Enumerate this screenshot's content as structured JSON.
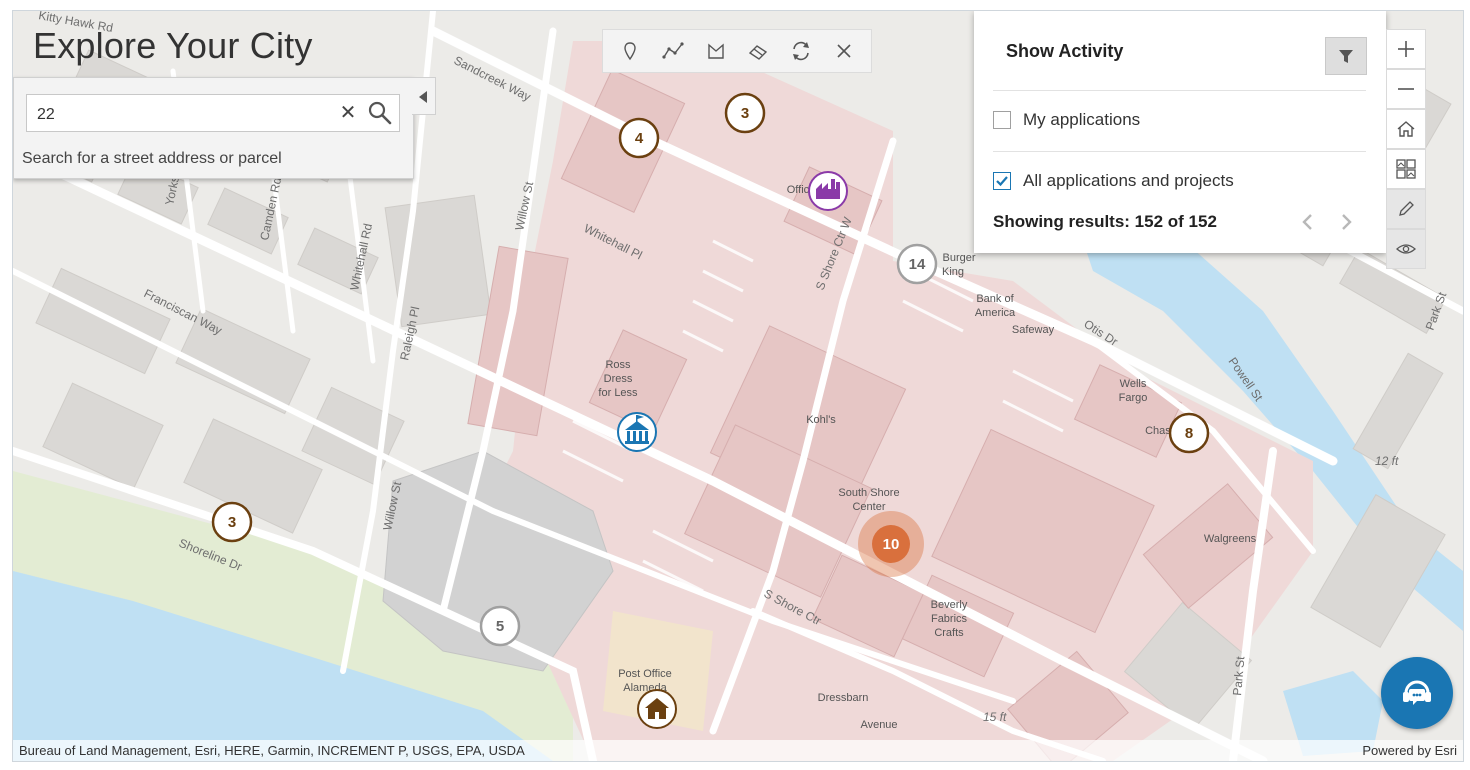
{
  "app": {
    "title": "Explore Your City"
  },
  "search": {
    "value": "22",
    "placeholder": "",
    "hint": "Search for a street address or parcel"
  },
  "activity_panel": {
    "title": "Show Activity",
    "options": [
      {
        "label": "My applications",
        "checked": false
      },
      {
        "label": "All applications and projects",
        "checked": true
      }
    ],
    "results_text": "Showing results: 152 of 152"
  },
  "draw_tools": [
    "point-tool-icon",
    "polyline-tool-icon",
    "polygon-tool-icon",
    "eraser-tool-icon",
    "refresh-icon",
    "close-icon"
  ],
  "map_controls": [
    "zoom-in",
    "zoom-out",
    "home",
    "basemap-gallery",
    "sketch",
    "visibility"
  ],
  "attribution": {
    "left": "Bureau of Land Management, Esri, HERE, Garmin, INCREMENT P, USGS, EPA, USDA",
    "right": "Powered by Esri"
  },
  "map": {
    "clusters": [
      {
        "count": "4",
        "color": "#6b4010"
      },
      {
        "count": "3",
        "color": "#6b4010"
      },
      {
        "count": "14",
        "color": "#a0a0a0"
      },
      {
        "count": "8",
        "color": "#6b4010"
      },
      {
        "count": "3",
        "color": "#6b4010"
      },
      {
        "count": "5",
        "color": "#a0a0a0"
      },
      {
        "count": "10",
        "color": "#d9703d"
      }
    ],
    "street_labels": [
      "Sandcreek Way",
      "Willow St",
      "Whitehall Pl",
      "S Shore Ctr W",
      "Franciscan Way",
      "Whitehall Rd",
      "Raleigh Pl",
      "Camden Rd",
      "Yorkshire",
      "Shoreline Dr",
      "Willow St",
      "S Shore Ctr",
      "Otis Dr",
      "Powell St",
      "Park St",
      "Park St",
      "Kitty Hawk Rd"
    ],
    "poi_labels": [
      "Ross",
      "Dress",
      "for Less",
      "Kohl's",
      "South Shore",
      "Center",
      "Bank of",
      "America",
      "Safeway",
      "Wells",
      "Fargo",
      "Walgreens",
      "Beverly",
      "Fabrics",
      "Crafts",
      "Post Office",
      "Alameda",
      "Dressbarn",
      "Avenue",
      "Burger",
      "King",
      "Office",
      "Chase"
    ],
    "elevation_labels": [
      "12 ft",
      "15 ft"
    ]
  },
  "colors": {
    "accent": "#1a76b3",
    "cluster_brown": "#6b4010",
    "cluster_gray": "#a0a0a0",
    "cluster_orange": "#d9703d",
    "commercial_fill": "#efd9d8",
    "water": "#bfe0f3",
    "grass": "#e3ecd3"
  }
}
